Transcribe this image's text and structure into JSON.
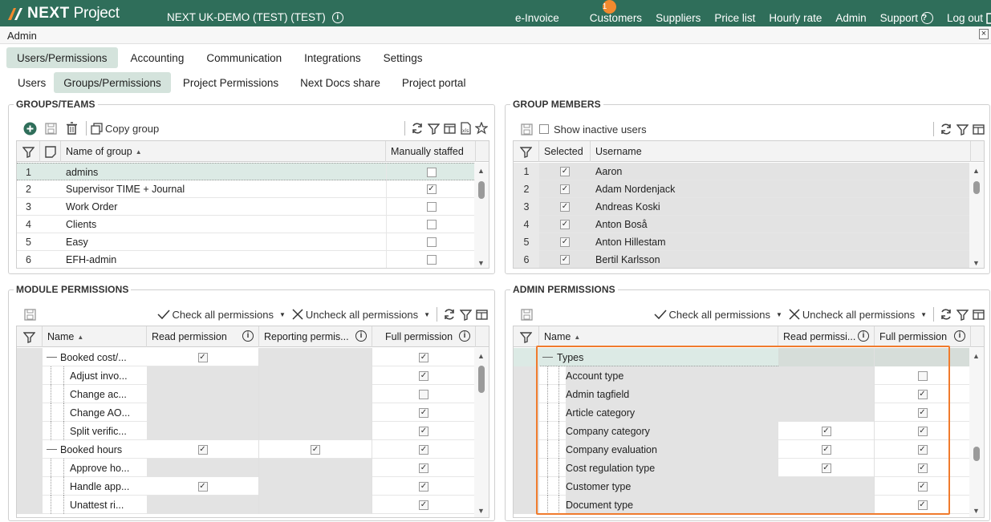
{
  "topbar": {
    "brand": "NEXT Project",
    "brand_strong": "NEXT",
    "brand_light": "Project",
    "company": "NEXT UK-DEMO (TEST) (TEST)",
    "nav": [
      {
        "label": "e-Invoice",
        "badge": "1"
      },
      {
        "label": "Customers"
      },
      {
        "label": "Suppliers"
      },
      {
        "label": "Price list"
      },
      {
        "label": "Hourly rate"
      },
      {
        "label": "Admin"
      },
      {
        "label": "Support"
      },
      {
        "label": "Log out"
      }
    ],
    "bg_color": "#2f6e5a",
    "badge_color": "#f28a2e"
  },
  "window": {
    "title": "Admin"
  },
  "tabs_main": [
    "Users/Permissions",
    "Accounting",
    "Communication",
    "Integrations",
    "Settings"
  ],
  "tabs_sub": [
    "Users",
    "Groups/Permissions",
    "Project Permissions",
    "Next Docs share",
    "Project portal"
  ],
  "groups": {
    "legend": "GROUPS/TEAMS",
    "copy_group": "Copy group",
    "col_name": "Name of group",
    "col_staffed": "Manually staffed",
    "rows": [
      {
        "n": "1",
        "name": "admins",
        "staffed": false
      },
      {
        "n": "2",
        "name": "Supervisor TIME + Journal",
        "staffed": true
      },
      {
        "n": "3",
        "name": "Work Order",
        "staffed": false
      },
      {
        "n": "4",
        "name": "Clients",
        "staffed": false
      },
      {
        "n": "5",
        "name": "Easy",
        "staffed": false
      },
      {
        "n": "6",
        "name": "EFH-admin",
        "staffed": false
      }
    ]
  },
  "members": {
    "legend": "GROUP MEMBERS",
    "show_inactive": "Show inactive users",
    "col_selected": "Selected",
    "col_username": "Username",
    "rows": [
      {
        "n": "1",
        "name": "Aaron"
      },
      {
        "n": "2",
        "name": "Adam Nordenjack"
      },
      {
        "n": "3",
        "name": "Andreas Koski"
      },
      {
        "n": "4",
        "name": "Anton Boså"
      },
      {
        "n": "5",
        "name": "Anton Hillestam"
      },
      {
        "n": "6",
        "name": "Bertil Karlsson"
      }
    ]
  },
  "module": {
    "legend": "MODULE PERMISSIONS",
    "check_all": "Check all permissions",
    "uncheck_all": "Uncheck all permissions",
    "col_name": "Name",
    "col_read": "Read permission",
    "col_report": "Reporting permis...",
    "col_full": "Full permission",
    "rows": [
      {
        "name": "Booked cost/...",
        "level": 0,
        "read": "checked",
        "report": "grey",
        "full": "checked"
      },
      {
        "name": "Adjust invo...",
        "level": 1,
        "read": "grey",
        "report": "grey",
        "full": "checked"
      },
      {
        "name": "Change ac...",
        "level": 1,
        "read": "grey",
        "report": "grey",
        "full": "unchecked"
      },
      {
        "name": "Change AO...",
        "level": 1,
        "read": "grey",
        "report": "grey",
        "full": "checked"
      },
      {
        "name": "Split verific...",
        "level": 1,
        "read": "grey",
        "report": "grey",
        "full": "checked"
      },
      {
        "name": "Booked hours",
        "level": 0,
        "read": "checked",
        "report": "checked",
        "full": "checked"
      },
      {
        "name": "Approve ho...",
        "level": 1,
        "read": "grey",
        "report": "grey",
        "full": "checked"
      },
      {
        "name": "Handle app...",
        "level": 1,
        "read": "checked",
        "report": "grey",
        "full": "checked"
      },
      {
        "name": "Unattest ri...",
        "level": 1,
        "read": "grey",
        "report": "grey",
        "full": "checked"
      }
    ]
  },
  "admin": {
    "legend": "ADMIN PERMISSIONS",
    "check_all": "Check all permissions",
    "uncheck_all": "Uncheck all permissions",
    "col_name": "Name",
    "col_read": "Read permissi...",
    "col_full": "Full permission",
    "highlight_color": "#f07b2d",
    "rows": [
      {
        "name": "Types",
        "level": 0,
        "read": "grey",
        "full": "grey"
      },
      {
        "name": "Account type",
        "level": 1,
        "read": "grey",
        "full": "unchecked"
      },
      {
        "name": "Admin tagfield",
        "level": 1,
        "read": "grey",
        "full": "checked"
      },
      {
        "name": "Article category",
        "level": 1,
        "read": "grey",
        "full": "checked"
      },
      {
        "name": "Company category",
        "level": 1,
        "read": "checked",
        "full": "checked"
      },
      {
        "name": "Company evaluation",
        "level": 1,
        "read": "checked",
        "full": "checked"
      },
      {
        "name": "Cost regulation type",
        "level": 1,
        "read": "checked",
        "full": "checked"
      },
      {
        "name": "Customer type",
        "level": 1,
        "read": "grey",
        "full": "checked"
      },
      {
        "name": "Document type",
        "level": 1,
        "read": "grey",
        "full": "checked"
      }
    ]
  }
}
